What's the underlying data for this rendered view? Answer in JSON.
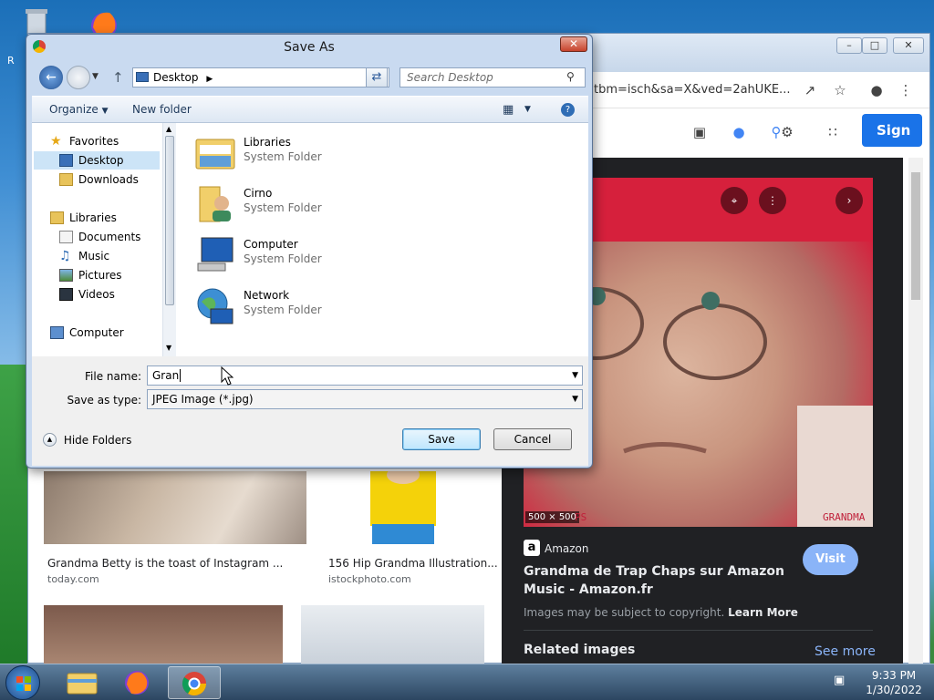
{
  "desktop": {
    "recycle_bin_partial": "R",
    "firefox_icon": "firefox-desktop-icon"
  },
  "browser": {
    "address_text": "tbm=isch&sa=X&ved=2ahUKE...",
    "sign_in_label": "Sign in",
    "results": [
      {
        "title": "Grandma Betty is the toast of Instagram ...",
        "source": "today.com"
      },
      {
        "title": "156 Hip Grandma Illustration...",
        "source": "istockphoto.com"
      }
    ],
    "panel": {
      "image_size": "500 × 500",
      "image_caption_left": "PS",
      "image_caption_right": "GRANDMA",
      "source_name": "Amazon",
      "visit_label": "Visit",
      "title": "Grandma de Trap Chaps sur Amazon Music - Amazon.fr",
      "copyright_text": "Images may be subject to copyright.",
      "learn_more": "Learn More",
      "related_label": "Related images",
      "see_more": "See more"
    }
  },
  "dialog": {
    "title": "Save As",
    "breadcrumb": "Desktop",
    "search_placeholder": "Search Desktop",
    "organize_label": "Organize",
    "new_folder_label": "New folder",
    "nav": {
      "favorites": "Favorites",
      "desktop": "Desktop",
      "downloads": "Downloads",
      "libraries": "Libraries",
      "documents": "Documents",
      "music": "Music",
      "pictures": "Pictures",
      "videos": "Videos",
      "computer": "Computer"
    },
    "files": [
      {
        "name": "Libraries",
        "type": "System Folder"
      },
      {
        "name": "Cirno",
        "type": "System Folder"
      },
      {
        "name": "Computer",
        "type": "System Folder"
      },
      {
        "name": "Network",
        "type": "System Folder"
      }
    ],
    "file_name_label": "File name:",
    "file_name_value": "Gran",
    "save_type_label": "Save as type:",
    "save_type_value": "JPEG Image (*.jpg)",
    "hide_folders": "Hide Folders",
    "save_label": "Save",
    "cancel_label": "Cancel"
  },
  "taskbar": {
    "time": "9:33 PM",
    "date": "1/30/2022"
  },
  "colors": {
    "google_blue": "#1a73e8",
    "panel_bg": "#202124",
    "visit_button": "#8ab4f8",
    "dialog_frame": "#c9daf0"
  }
}
